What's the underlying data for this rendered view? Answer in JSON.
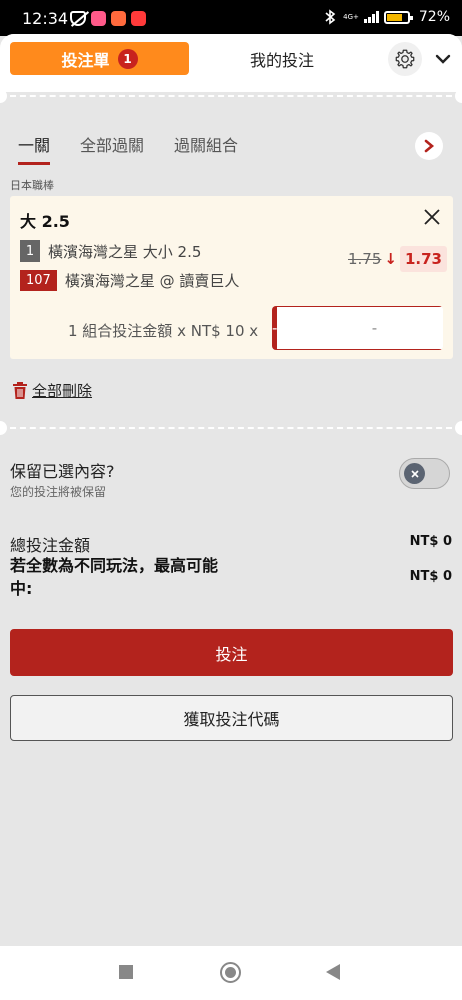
{
  "status_bar": {
    "time": "12:34",
    "network": "4G+",
    "battery": "72%"
  },
  "header": {
    "slip_tab_label": "投注單",
    "slip_count": "1",
    "my_bets_label": "我的投注",
    "settings_icon": "gear-icon",
    "collapse_icon": "chevron-down-icon"
  },
  "filter_tabs": [
    {
      "label": "一關",
      "active": true
    },
    {
      "label": "全部過關",
      "active": false
    },
    {
      "label": "過關組合",
      "active": false
    }
  ],
  "league": "日本職棒",
  "bet": {
    "title": "大 2.5",
    "selection_number": "1",
    "selection_text": "橫濱海灣之星 大小 2.5",
    "event_id": "107",
    "match_text": "橫濱海灣之星 @ 讀賣巨人",
    "old_odds": "1.75",
    "odds_direction": "↓",
    "new_odds": "1.73",
    "combo_text": "1 組合投注金額 x NT$ 10 x",
    "stepper": {
      "minus": "-",
      "value": "-",
      "plus": "+"
    }
  },
  "delete_all_label": "全部刪除",
  "keep_selection": {
    "title": "保留已選內容?",
    "subtitle": "您的投注將被保留",
    "enabled": false
  },
  "totals": {
    "total_label": "總投注金額",
    "total_value": "NT$ 0",
    "max_label": "若全數為不同玩法，最高可能中:",
    "max_value": "NT$ 0"
  },
  "actions": {
    "place_bet": "投注",
    "get_code": "獲取投注代碼"
  },
  "colors": {
    "accent_red": "#b3231d",
    "slip_orange": "#ff8a1c"
  }
}
